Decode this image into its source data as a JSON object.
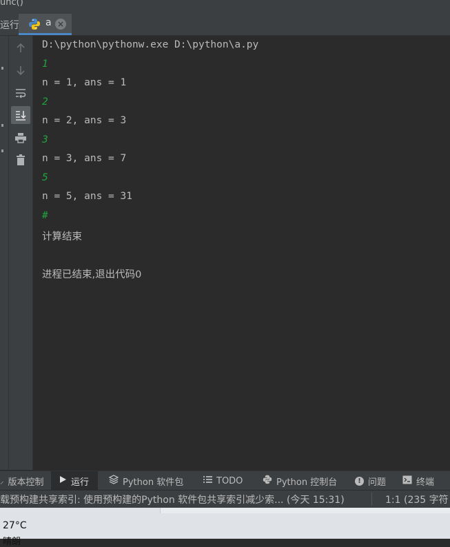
{
  "window": {
    "title_fragment": "unc()"
  },
  "run_panel": {
    "label": "运行:",
    "tab": {
      "name": "a",
      "close": "×"
    }
  },
  "toolbar": {
    "icons": [
      "arrow-up-icon",
      "arrow-down-icon",
      "soft-wrap-icon",
      "scroll-to-end-icon",
      "print-icon",
      "trash-icon"
    ]
  },
  "console": {
    "command": "D:\\python\\pythonw.exe D:\\python\\a.py",
    "lines": [
      {
        "text": "1",
        "type": "input"
      },
      {
        "text": "n = 1, ans = 1",
        "type": "output"
      },
      {
        "text": "2",
        "type": "input"
      },
      {
        "text": "n = 2, ans = 3",
        "type": "output"
      },
      {
        "text": "3",
        "type": "input"
      },
      {
        "text": "n = 3, ans = 7",
        "type": "output"
      },
      {
        "text": "5",
        "type": "input"
      },
      {
        "text": "n = 5, ans = 31",
        "type": "output"
      },
      {
        "text": "#",
        "type": "input"
      },
      {
        "text": "计算结束",
        "type": "output"
      }
    ],
    "exit_message": "进程已结束,退出代码0"
  },
  "bottom_tabs": [
    {
      "label": "版本控制",
      "icon": "branch-icon"
    },
    {
      "label": "运行",
      "icon": "play-icon",
      "selected": true
    },
    {
      "label": "Python 软件包",
      "icon": "layers-icon"
    },
    {
      "label": "TODO",
      "icon": "list-icon"
    },
    {
      "label": "Python 控制台",
      "icon": "python-icon"
    },
    {
      "label": "问题",
      "icon": "info-icon"
    },
    {
      "label": "终端",
      "icon": "terminal-icon"
    }
  ],
  "status_bar": {
    "message": "载预构建共享索引: 使用预构建的Python 软件包共享索引减少索... (今天 15:31)",
    "position": "1:1 (235 字符"
  },
  "taskbar": {
    "temperature": "27°C",
    "condition": "晴朗"
  },
  "colors": {
    "input_text": "#1fa53c",
    "console_bg": "#2b2b2b",
    "panel_bg": "#3c3f41",
    "tab_underline": "#4a88c7"
  }
}
